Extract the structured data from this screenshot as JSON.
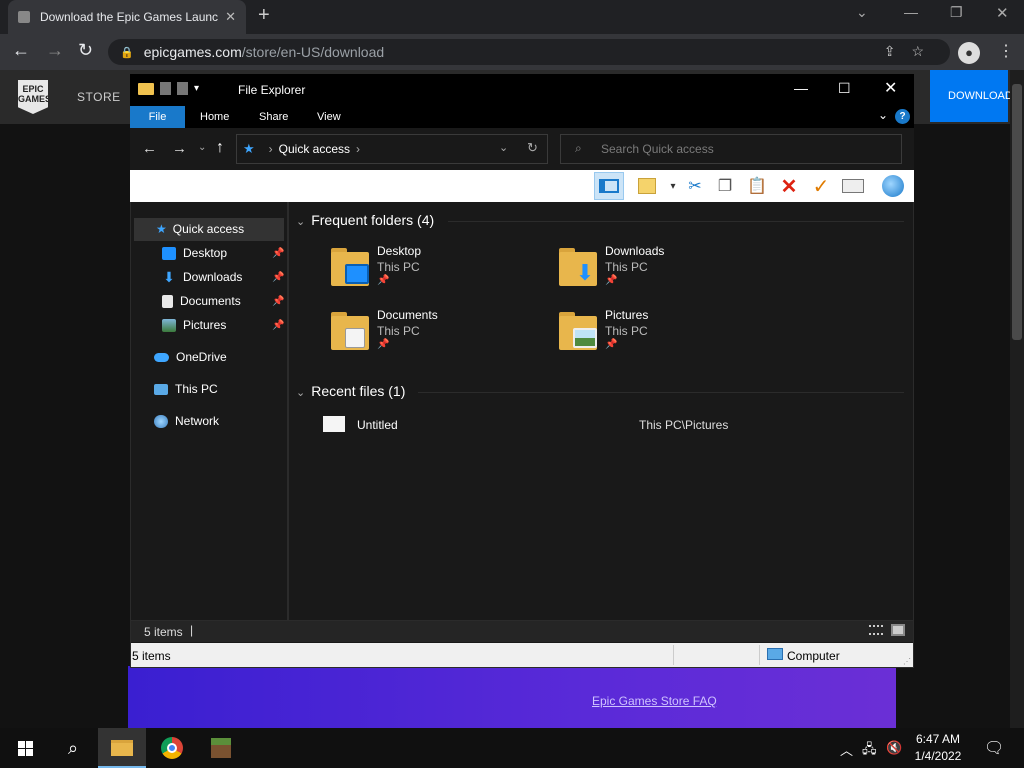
{
  "browser": {
    "tab_title": "Download the Epic Games Launc",
    "url_domain": "epicgames.com",
    "url_path": "/store/en-US/download"
  },
  "epic": {
    "logo_text": "EPIC GAMES",
    "store_label": "STORE",
    "download_label": "DOWNLOAD",
    "faq_link": "Epic Games Store FAQ"
  },
  "explorer": {
    "title": "File Explorer",
    "ribbon_tabs": [
      "File",
      "Home",
      "Share",
      "View"
    ],
    "path_label": "Quick access",
    "search_placeholder": "Search Quick access",
    "sidebar": [
      {
        "label": "Quick access",
        "icon": "star-icon"
      },
      {
        "label": "Desktop",
        "icon": "desktop-icon",
        "pinned": true
      },
      {
        "label": "Downloads",
        "icon": "download-icon",
        "pinned": true
      },
      {
        "label": "Documents",
        "icon": "documents-icon",
        "pinned": true
      },
      {
        "label": "Pictures",
        "icon": "pictures-icon",
        "pinned": true
      },
      {
        "label": "OneDrive",
        "icon": "cloud-icon"
      },
      {
        "label": "This PC",
        "icon": "computer-icon"
      },
      {
        "label": "Network",
        "icon": "network-icon"
      }
    ],
    "frequent_header": "Frequent folders (4)",
    "frequent": [
      {
        "name": "Desktop",
        "location": "This PC"
      },
      {
        "name": "Downloads",
        "location": "This PC"
      },
      {
        "name": "Documents",
        "location": "This PC"
      },
      {
        "name": "Pictures",
        "location": "This PC"
      }
    ],
    "recent_header": "Recent files (1)",
    "recent": [
      {
        "name": "Untitled",
        "path": "This PC\\Pictures"
      }
    ],
    "status_items": "5 items",
    "status_items2": "5 items",
    "status_computer": "Computer"
  },
  "taskbar": {
    "time": "6:47 AM",
    "date": "1/4/2022"
  },
  "colors": {
    "accent": "#1979ca",
    "epic_blue": "#0078f2",
    "folder": "#e8b64c"
  }
}
